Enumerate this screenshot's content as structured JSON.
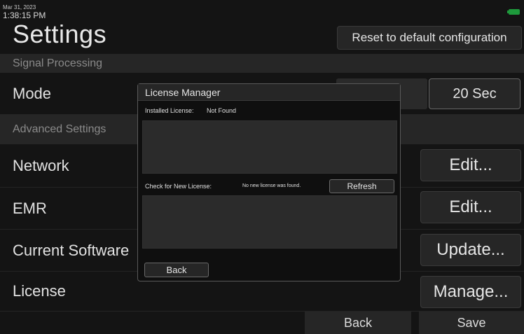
{
  "status": {
    "date": "Mar 31, 2023",
    "time": "1:38:15 PM",
    "battery_color": "#1e9a3c"
  },
  "header": {
    "title": "Settings",
    "reset_label": "Reset to default configuration"
  },
  "sections": {
    "signal_processing": "Signal Processing",
    "advanced_settings": "Advanced Settings"
  },
  "rows": {
    "mode": {
      "label": "Mode",
      "button": "20 Sec"
    },
    "network": {
      "label": "Network",
      "button": "Edit..."
    },
    "emr": {
      "label": "EMR",
      "button": "Edit..."
    },
    "software": {
      "label": "Current Software",
      "button": "Update..."
    },
    "license": {
      "label": "License",
      "button": "Manage..."
    }
  },
  "footer": {
    "back": "Back",
    "save": "Save"
  },
  "dialog": {
    "title": "License Manager",
    "installed_label": "Installed License:",
    "installed_value": "Not Found",
    "check_label": "Check for New License:",
    "check_status": "No new license was found.",
    "refresh": "Refresh",
    "back": "Back"
  }
}
